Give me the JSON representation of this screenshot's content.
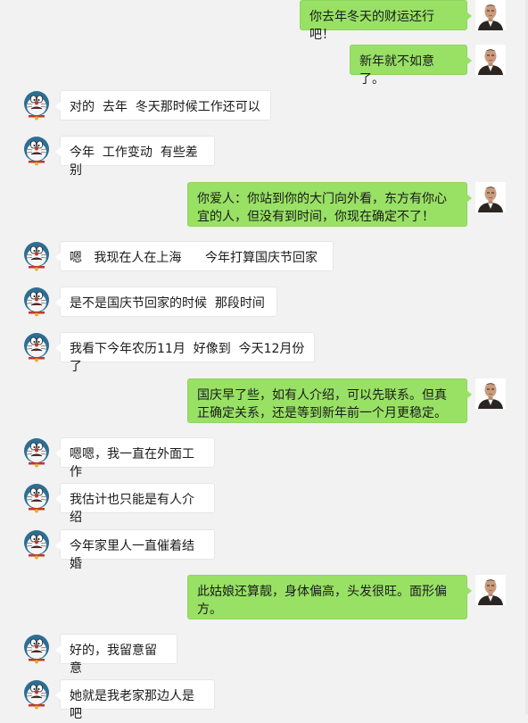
{
  "colors": {
    "background": "#f2f2f2",
    "bubble_self": "#98e165",
    "bubble_other": "#ffffff"
  },
  "avatars": {
    "self": "man-photo-avatar",
    "other": "doraemon-avatar"
  },
  "messages": [
    {
      "side": "right",
      "text": "你去年冬天的财运还行吧！"
    },
    {
      "side": "right",
      "text": "新年就不如意了。"
    },
    {
      "side": "left",
      "text": "对的  去年  冬天那时候工作还可以"
    },
    {
      "side": "left",
      "text": "今年  工作变动  有些差别"
    },
    {
      "side": "right",
      "text": "你爱人：你站到你的大门向外看，东方有你心宜的人，但没有到时间，你现在确定不了！"
    },
    {
      "side": "left",
      "text": "嗯   我现在人在上海      今年打算国庆节回家"
    },
    {
      "side": "left",
      "text": "是不是国庆节回家的时候  那段时间"
    },
    {
      "side": "left",
      "text": "我看下今年农历11月  好像到  今天12月份了"
    },
    {
      "side": "right",
      "text": "国庆早了些，如有人介绍，可以先联系。但真正确定关系，还是等到新年前一个月更稳定。"
    },
    {
      "side": "left",
      "text": "嗯嗯，我一直在外面工作"
    },
    {
      "side": "left",
      "text": "我估计也只能是有人介绍"
    },
    {
      "side": "left",
      "text": "今年家里人一直催着结婚"
    },
    {
      "side": "right",
      "text": "此姑娘还算靓，身体偏高，头发很旺。面形偏方。"
    },
    {
      "side": "left",
      "text": "好的，我留意留意"
    },
    {
      "side": "left",
      "text": "她就是我老家那边人是吧"
    }
  ]
}
